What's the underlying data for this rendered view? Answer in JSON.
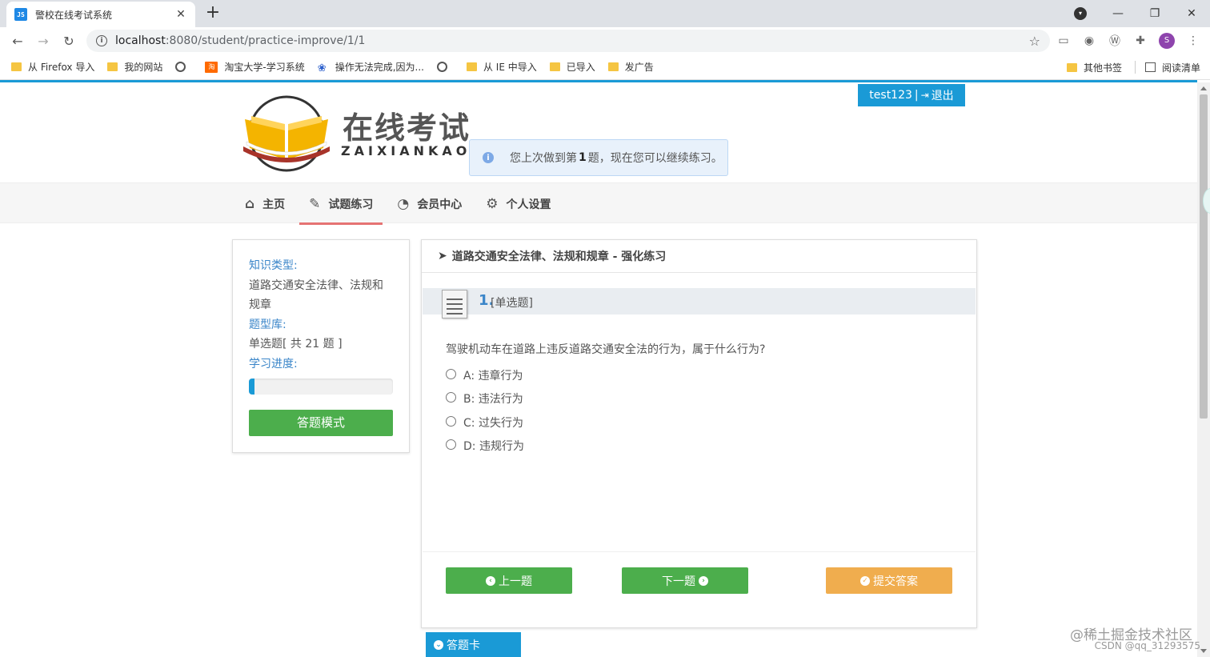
{
  "browser": {
    "tab_title": "警校在线考试系统",
    "tab_favicon": "JS",
    "url_host": "localhost",
    "url_rest": ":8080/student/practice-improve/1/1",
    "avatar_letter": "S",
    "bookmarks": [
      "从 Firefox 导入",
      "我的网站",
      "淘宝大学-学习系统",
      "操作无法完成,因为...",
      "从 IE 中导入",
      "已导入",
      "发广告"
    ],
    "bookmarks_right": [
      "其他书签",
      "阅读清单"
    ]
  },
  "header": {
    "logo_title": "在线考试",
    "logo_sub": "ZAIXIANKAOSH",
    "username": "test123",
    "logout_label": "退出",
    "notice_prefix": "您上次做到第",
    "notice_num": "1",
    "notice_suffix": "题，现在您可以继续练习。"
  },
  "nav": {
    "items": [
      "主页",
      "试题练习",
      "会员中心",
      "个人设置"
    ],
    "active": "试题练习"
  },
  "sidebar": {
    "knowledge_label": "知识类型:",
    "knowledge_value": "道路交通安全法律、法规和规章",
    "bank_label": "题型库:",
    "bank_value": "单选题[ 共 21 题 ]",
    "progress_label": "学习进度:",
    "progress_fraction": 0.04,
    "mode_button": "答题模式"
  },
  "question": {
    "panel_title": "道路交通安全法律、法规和规章 - 强化练习",
    "number": "1.",
    "type": "[单选题]",
    "text": "驾驶机动车在道路上违反道路交通安全法的行为，属于什么行为?",
    "options": [
      "A: 违章行为",
      "B: 违法行为",
      "C: 过失行为",
      "D: 违规行为"
    ]
  },
  "actions": {
    "prev": "上一题",
    "next": "下一题",
    "submit": "提交答案",
    "answer_card": "答题卡"
  },
  "watermark": {
    "line1": "@稀土掘金技术社区",
    "line2": "CSDN @qq_31293575"
  },
  "colors": {
    "brand_blue": "#1a9ad6",
    "green": "#4cae4c",
    "orange": "#f0ad4e",
    "nav_active": "#e57373"
  }
}
